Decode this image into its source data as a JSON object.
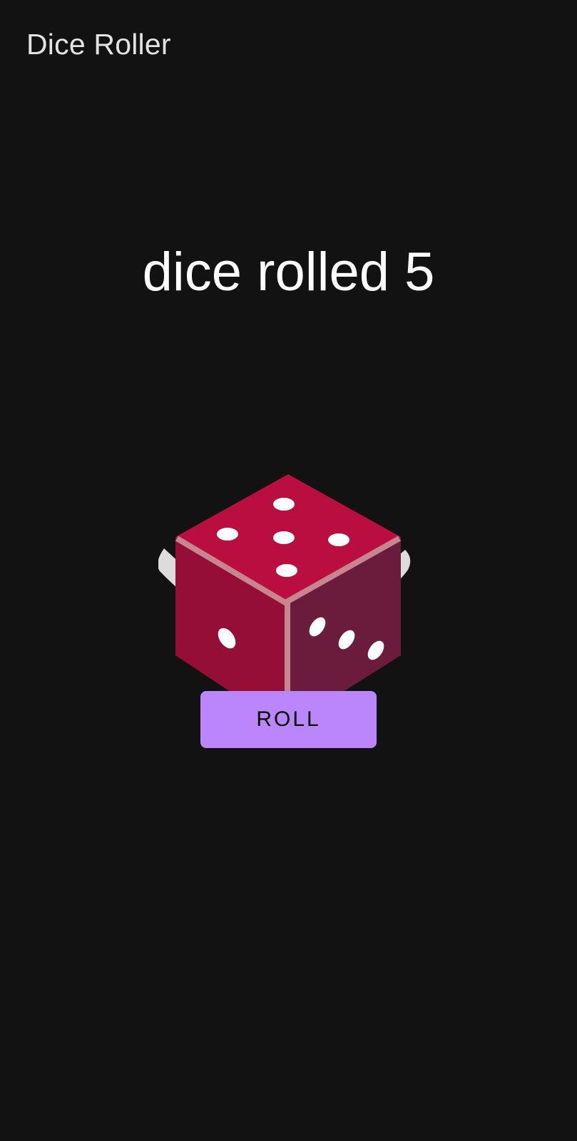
{
  "app_bar": {
    "title": "Dice Roller"
  },
  "main": {
    "result_text": "dice rolled 5",
    "dice": {
      "top_face_pips": 5,
      "left_face_pips": 1,
      "right_face_pips": 3,
      "colors": {
        "top": "#b90e3f",
        "left": "#950e38",
        "right": "#6b1c3c",
        "edge": "#c7868f",
        "pip": "#ffffff",
        "shadow": "#dcdcdc"
      }
    },
    "roll_button": {
      "label": "Roll",
      "color": "#bb86fc"
    }
  },
  "theme": {
    "background": "#121212",
    "title_color": "#e3e3e3",
    "text_color": "#ffffff"
  }
}
